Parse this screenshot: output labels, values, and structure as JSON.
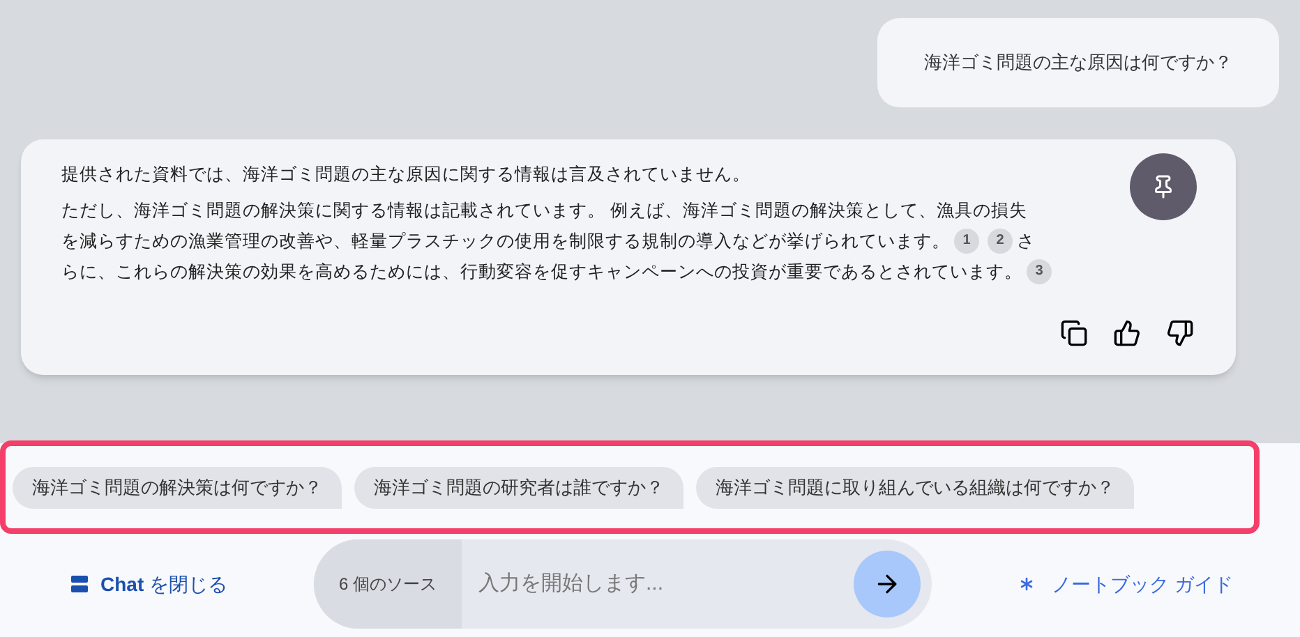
{
  "user_message": "海洋ゴミ問題の主な原因は何ですか？",
  "response": {
    "paragraphs": [
      {
        "lines": [
          [
            {
              "kind": "text",
              "text": "提供された資料では、海洋ゴミ問題の主な原因に関する情報は言及されていません。"
            }
          ]
        ]
      },
      {
        "lines": [
          [
            {
              "kind": "text",
              "text": "ただし、海洋ゴミ問題の解決策に関する情報は記載されています。 例えば、海洋ゴミ問題の解決策として、漁具の損失"
            }
          ],
          [
            {
              "kind": "text",
              "text": "を減らすための漁業管理の改善や、軽量プラスチックの使用を制限する規制の導入などが挙げられています。"
            },
            {
              "kind": "citation",
              "text": "1"
            },
            {
              "kind": "citation",
              "text": "2"
            },
            {
              "kind": "text",
              "text": "さ"
            }
          ],
          [
            {
              "kind": "text",
              "text": "らに、これらの解決策の効果を高めるためには、行動変容を促すキャンペーンへの投資が重要であるとされています。"
            },
            {
              "kind": "citation",
              "text": "3"
            }
          ]
        ]
      }
    ]
  },
  "suggestions": [
    "海洋ゴミ問題の解決策は何ですか？",
    "海洋ゴミ問題の研究者は誰ですか？",
    "海洋ゴミ問題に取り組んでいる組織は何ですか？"
  ],
  "close_chat": {
    "bold": "Chat",
    "rest": "を閉じる"
  },
  "sources": "6 個のソース",
  "input": {
    "placeholder": "入力を開始します..."
  },
  "notebook_guide": "ノートブック ガイド"
}
